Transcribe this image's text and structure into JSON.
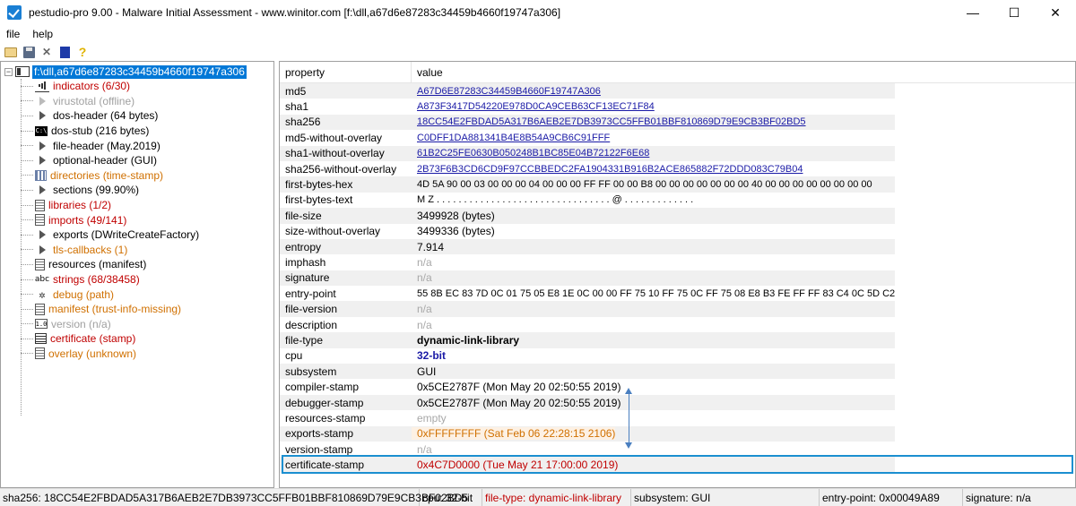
{
  "window": {
    "title": "pestudio-pro 9.00 - Malware Initial Assessment - www.winitor.com [f:\\dll,a67d6e87283c34459b4660f19747a306]",
    "minimize": "—",
    "maximize": "☐",
    "close": "✕"
  },
  "menu": {
    "file": "file",
    "help": "help"
  },
  "tree": {
    "root": "f:\\dll,a67d6e87283c34459b4660f19747a306",
    "items": [
      {
        "label": "indicators (6/30)",
        "color": "red",
        "icon": "bars-icon"
      },
      {
        "label": "virustotal (offline)",
        "color": "gray",
        "icon": "arrow-icon"
      },
      {
        "label": "dos-header (64 bytes)",
        "color": "black",
        "icon": "arrow-icon"
      },
      {
        "label": "dos-stub (216 bytes)",
        "color": "black",
        "icon": "dos-icon"
      },
      {
        "label": "file-header (May.2019)",
        "color": "black",
        "icon": "arrow-icon"
      },
      {
        "label": "optional-header (GUI)",
        "color": "black",
        "icon": "arrow-icon"
      },
      {
        "label": "directories (time-stamp)",
        "color": "orange",
        "icon": "grid-icon"
      },
      {
        "label": "sections (99.90%)",
        "color": "black",
        "icon": "arrow-icon"
      },
      {
        "label": "libraries (1/2)",
        "color": "red",
        "icon": "doc-icon"
      },
      {
        "label": "imports (49/141)",
        "color": "red",
        "icon": "doc-icon"
      },
      {
        "label": "exports (DWriteCreateFactory)",
        "color": "black",
        "icon": "arrow-icon"
      },
      {
        "label": "tls-callbacks (1)",
        "color": "orange",
        "icon": "arrow-icon"
      },
      {
        "label": "resources (manifest)",
        "color": "black",
        "icon": "doc-icon"
      },
      {
        "label": "strings (68/38458)",
        "color": "red",
        "icon": "abc-icon"
      },
      {
        "label": "debug (path)",
        "color": "orange",
        "icon": "bug-icon"
      },
      {
        "label": "manifest (trust-info-missing)",
        "color": "orange",
        "icon": "doc-icon"
      },
      {
        "label": "version (n/a)",
        "color": "gray",
        "icon": "version-icon"
      },
      {
        "label": "certificate (stamp)",
        "color": "red",
        "icon": "certificate-icon"
      },
      {
        "label": "overlay (unknown)",
        "color": "orange",
        "icon": "doc-icon"
      }
    ]
  },
  "table": {
    "col_property": "property",
    "col_value": "value",
    "rows": [
      {
        "k": "md5",
        "v": "A67D6E87283C34459B4660F19747A306",
        "style": "link"
      },
      {
        "k": "sha1",
        "v": "A873F3417D54220E978D0CA9CEB63CF13EC71F84",
        "style": "link"
      },
      {
        "k": "sha256",
        "v": "18CC54E2FBDAD5A317B6AEB2E7DB3973CC5FFB01BBF810869D79E9CB3BF02BD5",
        "style": "link"
      },
      {
        "k": "md5-without-overlay",
        "v": "C0DFF1DA881341B4E8B54A9CB6C91FFF",
        "style": "link"
      },
      {
        "k": "sha1-without-overlay",
        "v": "61B2C25FE0630B050248B1BC85E04B72122F6E68",
        "style": "link"
      },
      {
        "k": "sha256-without-overlay",
        "v": "2B73F6B3CD6CD9F97CCBBEDC2FA1904331B916B2ACE865882F72DDD083C79B04",
        "style": "link"
      },
      {
        "k": "first-bytes-hex",
        "v": "4D 5A 90 00 03 00 00 00 04 00 00 00 FF FF 00 00 B8 00 00 00 00 00 00 00 40 00 00 00 00 00 00 00 00",
        "style": "mono"
      },
      {
        "k": "first-bytes-text",
        "v": "M Z . . . . . . . . . . . . . . . . . . . . . . . . . . . . . . . . @ . . . . . . . . . . . . .",
        "style": "mono"
      },
      {
        "k": "file-size",
        "v": "3499928 (bytes)",
        "style": "plain"
      },
      {
        "k": "size-without-overlay",
        "v": "3499336 (bytes)",
        "style": "plain"
      },
      {
        "k": "entropy",
        "v": "7.914",
        "style": "plain"
      },
      {
        "k": "imphash",
        "v": "n/a",
        "style": "na"
      },
      {
        "k": "signature",
        "v": "n/a",
        "style": "na"
      },
      {
        "k": "entry-point",
        "v": "55 8B EC 83 7D 0C 01 75 05 E8 1E 0C 00 00 FF 75 10 FF 75 0C FF 75 08 E8 B3 FE FF FF 83 C4 0C 5D C2",
        "style": "mono"
      },
      {
        "k": "file-version",
        "v": "n/a",
        "style": "na"
      },
      {
        "k": "description",
        "v": "n/a",
        "style": "na"
      },
      {
        "k": "file-type",
        "v": "dynamic-link-library",
        "style": "bold"
      },
      {
        "k": "cpu",
        "v": "32-bit",
        "style": "bluebold"
      },
      {
        "k": "subsystem",
        "v": "GUI",
        "style": "plain"
      },
      {
        "k": "compiler-stamp",
        "v": "0x5CE2787F (Mon May 20 02:50:55 2019)",
        "style": "plain"
      },
      {
        "k": "debugger-stamp",
        "v": "0x5CE2787F (Mon May 20 02:50:55 2019)",
        "style": "plain"
      },
      {
        "k": "resources-stamp",
        "v": "empty",
        "style": "na"
      },
      {
        "k": "exports-stamp",
        "v": "0xFFFFFFFF (Sat Feb 06 22:28:15 2106)",
        "style": "orange"
      },
      {
        "k": "version-stamp",
        "v": "n/a",
        "style": "na"
      },
      {
        "k": "certificate-stamp",
        "v": "0x4C7D0000 (Tue May 21 17:00:00 2019)",
        "style": "red"
      }
    ]
  },
  "status": {
    "sha256": "sha256: 18CC54E2FBDAD5A317B6AEB2E7DB3973CC5FFB01BBF810869D79E9CB3BF02BD5",
    "cpu": "cpu: 32-bit",
    "filetype": "file-type: dynamic-link-library",
    "subsystem": "subsystem: GUI",
    "entrypoint": "entry-point: 0x00049A89",
    "signature": "signature: n/a"
  }
}
